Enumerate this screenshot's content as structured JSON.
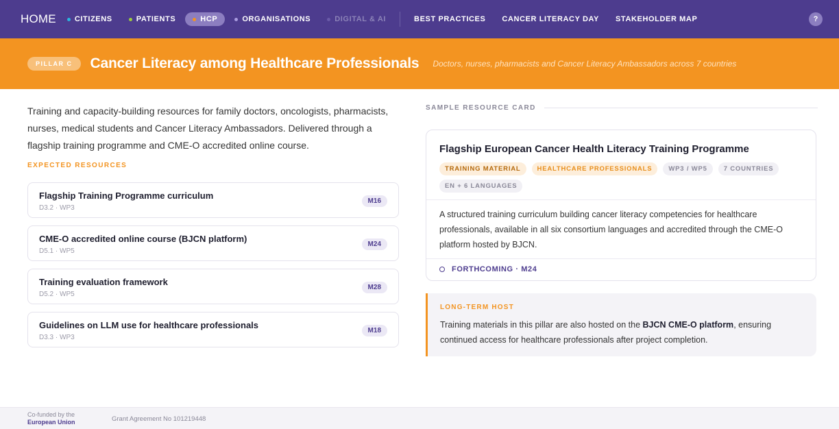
{
  "nav": {
    "home": "HOME",
    "items": [
      {
        "label": "CITIZENS",
        "dot_color": "#29b6e0"
      },
      {
        "label": "PATIENTS",
        "dot_color": "#9ccc3d"
      },
      {
        "label": "HCP",
        "dot_color": "#f39421",
        "active": true
      },
      {
        "label": "ORGANISATIONS",
        "dot_color": "#a99be0"
      },
      {
        "label": "DIGITAL & AI",
        "dot_color": "#6a5ba8",
        "muted": true
      }
    ],
    "links": [
      "BEST PRACTICES",
      "CANCER LITERACY DAY",
      "STAKEHOLDER MAP"
    ],
    "help": "?"
  },
  "banner": {
    "pill": "PILLAR C",
    "title": "Cancer Literacy among Healthcare Professionals",
    "subtitle": "Doctors, nurses, pharmacists and Cancer Literacy Ambassadors across 7 countries"
  },
  "intro": "Training and capacity-building resources for family doctors, oncologists, pharmacists, nurses, medical students and Cancer Literacy Ambassadors. Delivered through a flagship training programme and CME-O accredited online course.",
  "expected": {
    "label": "EXPECTED RESOURCES",
    "items": [
      {
        "title": "Flagship Training Programme curriculum",
        "sub": "D3.2 · WP3",
        "badge": "M16"
      },
      {
        "title": "CME-O accredited online course (BJCN platform)",
        "sub": "D5.1 · WP5",
        "badge": "M24"
      },
      {
        "title": "Training evaluation framework",
        "sub": "D5.2 · WP5",
        "badge": "M28"
      },
      {
        "title": "Guidelines on LLM use for healthcare professionals",
        "sub": "D3.3 · WP3",
        "badge": "M18"
      }
    ]
  },
  "sample": {
    "label": "SAMPLE RESOURCE CARD",
    "title": "Flagship European Cancer Health Literacy Training Programme",
    "tags": [
      "TRAINING MATERIAL",
      "HEALTHCARE PROFESSIONALS",
      "WP3 / WP5",
      "7 COUNTRIES",
      "EN + 6 LANGUAGES"
    ],
    "description": "A structured training curriculum building cancer literacy competencies for healthcare professionals, available in all six consortium languages and accredited through the CME-O platform hosted by BJCN.",
    "status": "FORTHCOMING · M24"
  },
  "host": {
    "label": "LONG-TERM HOST",
    "text_before": "Training materials in this pillar are also hosted on the ",
    "text_bold": "BJCN CME-O platform",
    "text_after": ", ensuring continued access for healthcare professionals after project completion."
  },
  "footer": {
    "cofunded_line1": "Co-funded by the",
    "cofunded_line2": "European Union",
    "grant": "Grant Agreement No 101219448"
  },
  "colors": {
    "nav_bg": "#4d3c8e",
    "banner_bg": "#f39421",
    "accent": "#f39421"
  }
}
